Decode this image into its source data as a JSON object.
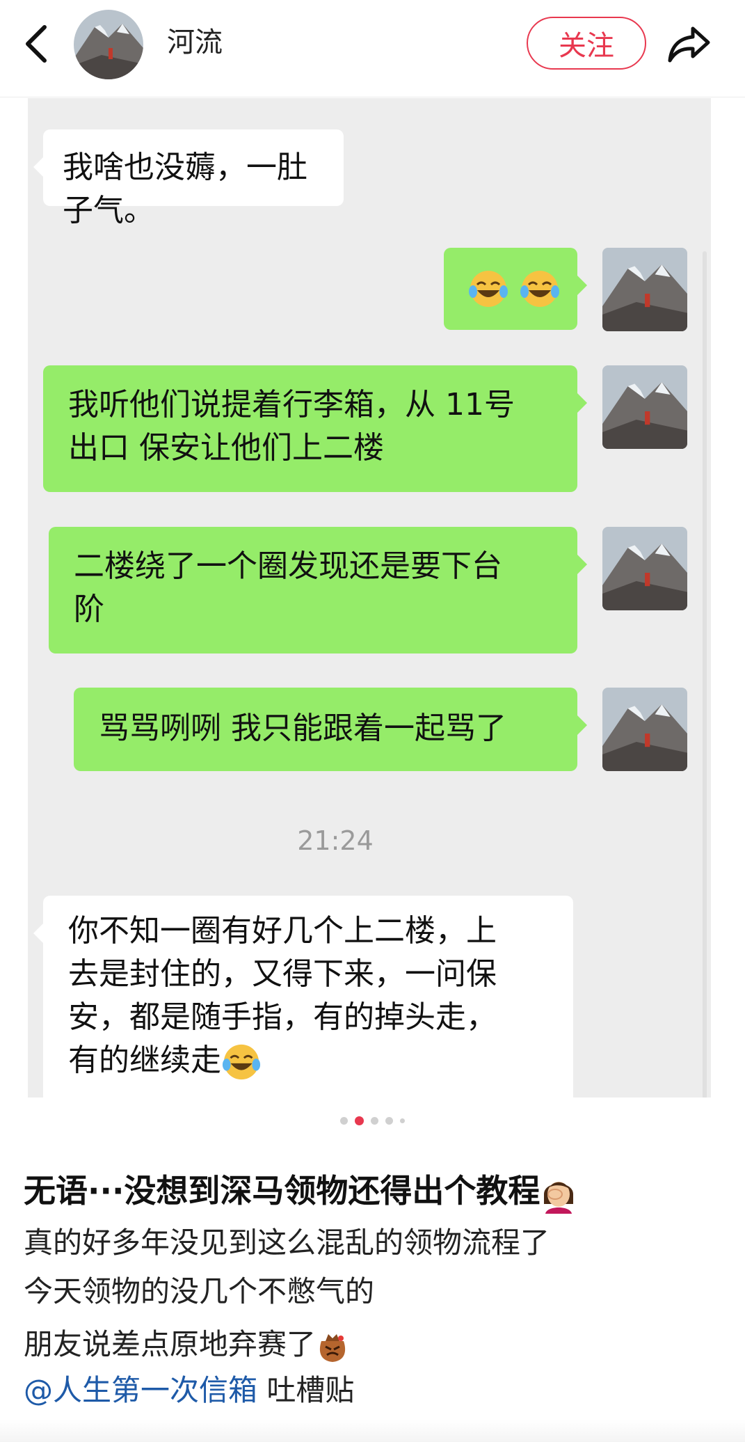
{
  "header": {
    "username": "河流",
    "follow_label": "关注",
    "back_icon": "chevron-left-icon",
    "share_icon": "share-arrow-icon"
  },
  "chat": {
    "messages": [
      {
        "side": "left",
        "text": "我啥也没薅，一肚子气。"
      },
      {
        "side": "right",
        "text": "",
        "emoji": [
          "laughing-tears-emoji",
          "laughing-tears-emoji"
        ]
      },
      {
        "side": "right",
        "lines": [
          "我听他们说提着行李箱，从 11号",
          "出口 保安让他们上二楼"
        ]
      },
      {
        "side": "right",
        "lines": [
          "二楼绕了一个圈发现还是要下台",
          "阶"
        ]
      },
      {
        "side": "right",
        "text": "骂骂咧咧 我只能跟着一起骂了"
      },
      {
        "side": "left",
        "lines": [
          "你不知一圈有好几个上二楼，上",
          "去是封住的，又得下来，一问保",
          "安，都是随手指，有的掉头走，",
          "有的继续走"
        ]
      }
    ],
    "timestamp": "21:24"
  },
  "pager": {
    "count": 5,
    "active_index": 1
  },
  "post": {
    "title": "无语···没想到深马领物还得出个教程",
    "title_emoji": "facepalm-woman-emoji",
    "lines": [
      "真的好多年没见到这么混乱的领物流程了",
      "今天领物的没几个不憋气的",
      "朋友说差点原地弃赛了"
    ],
    "line3_emoji": "angry-bag-emoji",
    "mention": "@人生第一次信箱",
    "mention_suffix": " 吐槽贴"
  },
  "colors": {
    "accent_red": "#e8384f",
    "bubble_green": "#95ec69",
    "chat_bg": "#ededed",
    "mention_blue": "#1e5aa8"
  }
}
